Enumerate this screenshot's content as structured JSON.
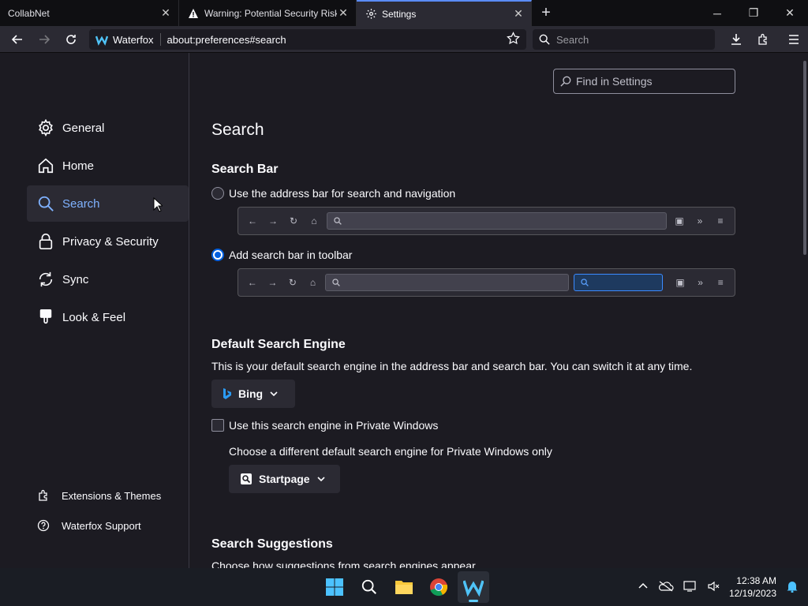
{
  "tabs": [
    {
      "title": "CollabNet",
      "icon": "none"
    },
    {
      "title": "Warning: Potential Security Risk",
      "icon": "warning-icon"
    },
    {
      "title": "Settings",
      "icon": "gear-icon"
    }
  ],
  "window": {
    "new_tab": "+",
    "minimize": "─",
    "restore": "❐",
    "close": "✕"
  },
  "navbar": {
    "brand": "Waterfox",
    "url": "about:preferences#search",
    "search_placeholder": "Search"
  },
  "sidebar": {
    "items": [
      {
        "label": "General",
        "icon": "gear-icon"
      },
      {
        "label": "Home",
        "icon": "home-icon"
      },
      {
        "label": "Search",
        "icon": "search-icon"
      },
      {
        "label": "Privacy & Security",
        "icon": "lock-icon"
      },
      {
        "label": "Sync",
        "icon": "sync-icon"
      },
      {
        "label": "Look & Feel",
        "icon": "paintbrush-icon"
      }
    ],
    "footer": [
      {
        "label": "Extensions & Themes",
        "icon": "puzzle-icon"
      },
      {
        "label": "Waterfox Support",
        "icon": "help-icon"
      }
    ]
  },
  "main": {
    "find_placeholder": "Find in Settings",
    "title": "Search",
    "search_bar": {
      "heading": "Search Bar",
      "option1": "Use the address bar for search and navigation",
      "option2": "Add search bar in toolbar",
      "selected": "option2"
    },
    "default_engine": {
      "heading": "Default Search Engine",
      "description": "This is your default search engine in the address bar and search bar. You can switch it at any time.",
      "engine": "Bing",
      "private_checkbox": "Use this search engine in Private Windows",
      "private_description": "Choose a different default search engine for Private Windows only",
      "private_engine": "Startpage"
    },
    "suggestions": {
      "heading": "Search Suggestions",
      "description": "Choose how suggestions from search engines appear"
    }
  },
  "taskbar": {
    "time": "12:38 AM",
    "date": "12/19/2023"
  }
}
